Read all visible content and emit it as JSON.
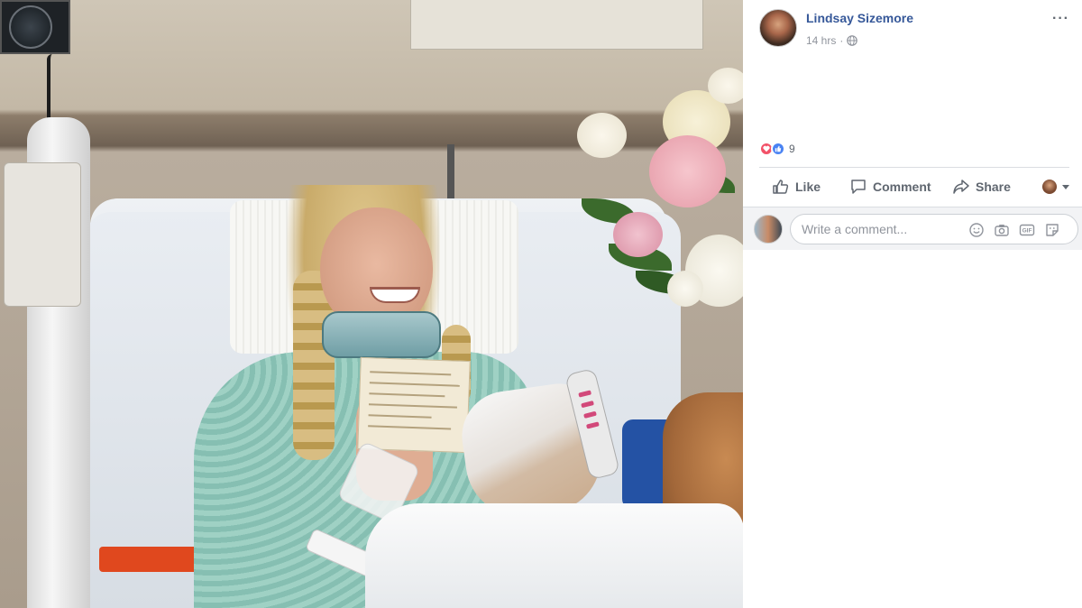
{
  "post": {
    "author_name": "Lindsay Sizemore",
    "timestamp": "14 hrs",
    "separator": "·",
    "privacy_icon": "globe-icon",
    "more_icon": "more-options-icon",
    "more_label": "···"
  },
  "reactions": {
    "types": [
      "love",
      "like"
    ],
    "count": "9"
  },
  "actions": {
    "like_label": "Like",
    "comment_label": "Comment",
    "share_label": "Share"
  },
  "comment_box": {
    "placeholder": "Write a comment...",
    "icons": [
      "emoji-icon",
      "camera-icon",
      "gif-icon",
      "sticker-icon"
    ],
    "gif_label": "GIF"
  },
  "colors": {
    "author_link": "#365899",
    "meta_text": "#90949c",
    "action_text": "#606770",
    "love": "#f25268",
    "like": "#4a83f3"
  }
}
